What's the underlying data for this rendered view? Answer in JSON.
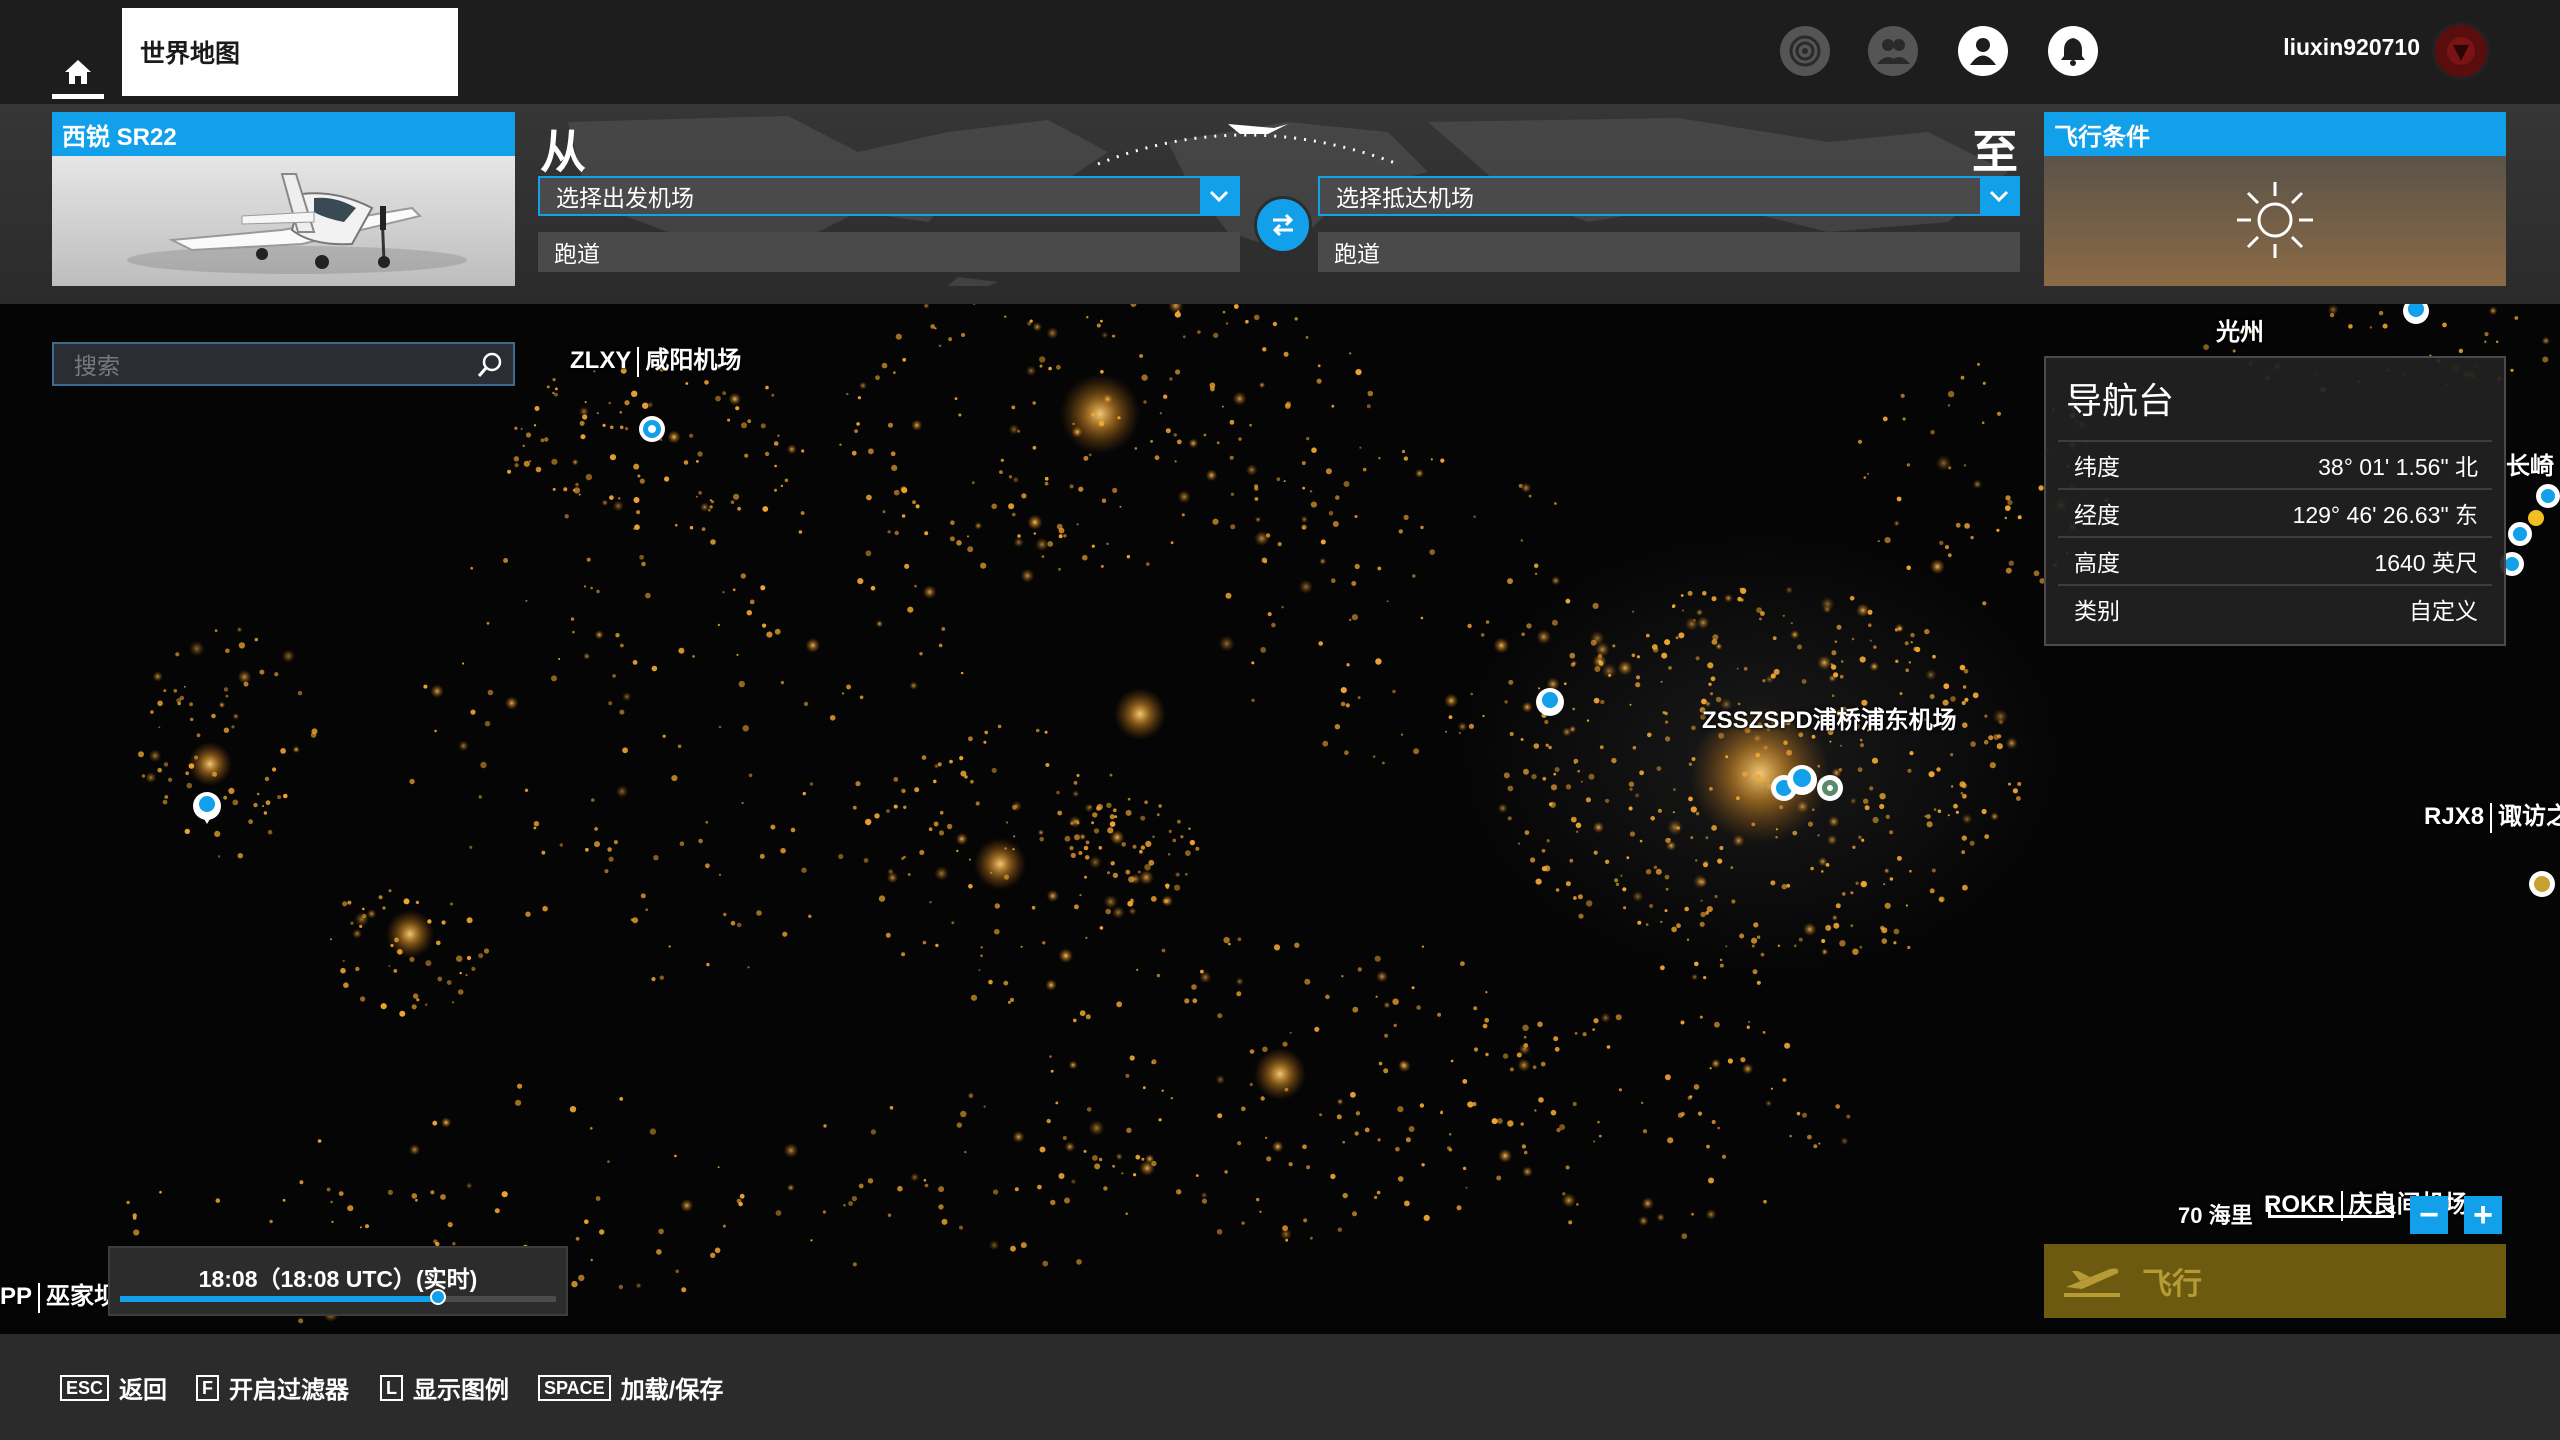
{
  "topbar": {
    "world_map_tab": "世界地图",
    "username": "liuxin920710",
    "icons": [
      "home-icon",
      "achievements-icon",
      "friends-icon",
      "profile-icon",
      "notifications-icon"
    ]
  },
  "aircraft": {
    "name": "西锐 SR22"
  },
  "route": {
    "from_label": "从",
    "to_label": "至",
    "departure_placeholder": "选择出发机场",
    "arrival_placeholder": "选择抵达机场",
    "departure_runway": "跑道",
    "arrival_runway": "跑道"
  },
  "conditions": {
    "title": "飞行条件",
    "weather_icon": "sun-icon"
  },
  "search": {
    "placeholder": "搜索"
  },
  "map_labels": {
    "zlxy_code": "ZLXY",
    "zlxy_name": "咸阳机场",
    "zsss_text": "ZSSZSPD浦桥浦东机场",
    "gwangju": "光州",
    "nagasaki": "长崎",
    "rjx8_code": "RJX8",
    "rjx8_name": "诹访之",
    "pp_code": "PP",
    "pp_name": "巫家坝",
    "rokr_code": "ROKR",
    "rokr_name": "庆良间机场"
  },
  "nav_panel": {
    "title": "导航台",
    "rows": [
      {
        "label": "纬度",
        "value": "38° 01' 1.56\" 北"
      },
      {
        "label": "经度",
        "value": "129° 46' 26.63\" 东"
      },
      {
        "label": "高度",
        "value": "1640 英尺"
      },
      {
        "label": "类别",
        "value": "自定义"
      }
    ]
  },
  "time": {
    "text": "18:08（18:08 UTC）(实时)",
    "position": 0.73
  },
  "zoom": {
    "scale_text": "70 海里",
    "minus": "−",
    "plus": "+"
  },
  "fly": {
    "label": "飞行"
  },
  "hints": [
    {
      "key": "ESC",
      "label": "返回"
    },
    {
      "key": "F",
      "label": "开启过滤器"
    },
    {
      "key": "L",
      "label": "显示图例"
    },
    {
      "key": "SPACE",
      "label": "加载/保存"
    }
  ],
  "colors": {
    "accent": "#12a0ea",
    "city_lights": "#f0a530",
    "fly_button": "#6b5a10"
  }
}
